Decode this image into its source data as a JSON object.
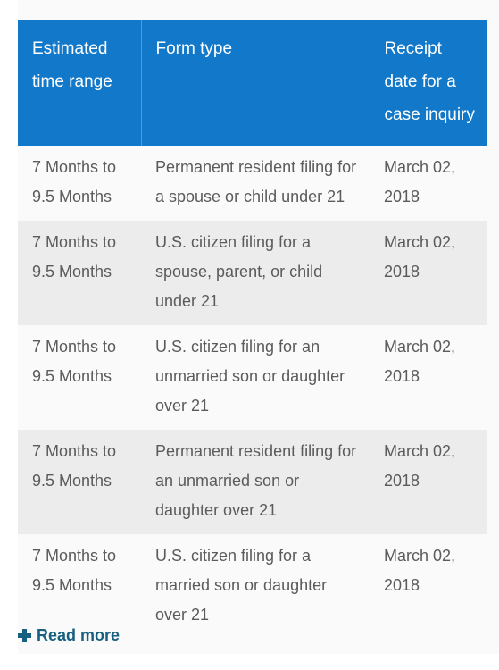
{
  "table": {
    "columns": [
      {
        "key": "estimated_time_range",
        "label": "Estimated time range"
      },
      {
        "key": "form_type",
        "label": "Form type"
      },
      {
        "key": "receipt_date",
        "label": "Receipt date for a case inquiry"
      }
    ],
    "rows": [
      {
        "estimated_time_range": "7 Months to 9.5 Months",
        "form_type": "Permanent resident filing for a spouse or child under 21",
        "receipt_date": "March 02, 2018"
      },
      {
        "estimated_time_range": "7 Months to 9.5 Months",
        "form_type": "U.S. citizen filing for a spouse, parent, or child under 21",
        "receipt_date": "March 02, 2018"
      },
      {
        "estimated_time_range": "7 Months to 9.5 Months",
        "form_type": "U.S. citizen filing for an unmarried son or daughter over 21",
        "receipt_date": "March 02, 2018"
      },
      {
        "estimated_time_range": "7 Months to 9.5 Months",
        "form_type": "Permanent resident filing for an unmarried son or daughter over 21",
        "receipt_date": "March 02, 2018"
      },
      {
        "estimated_time_range": "7 Months to 9.5 Months",
        "form_type": "U.S. citizen filing for a married son or daughter over 21",
        "receipt_date": "March 02, 2018"
      }
    ]
  },
  "read_more": {
    "label": "Read more",
    "icon": "plus-icon"
  },
  "colors": {
    "header_background": "#1278c9",
    "header_text": "#ffffff",
    "row_odd_background": "#fafafa",
    "row_even_background": "#ececec",
    "body_text": "#5b5b5b",
    "link": "#17607f"
  }
}
